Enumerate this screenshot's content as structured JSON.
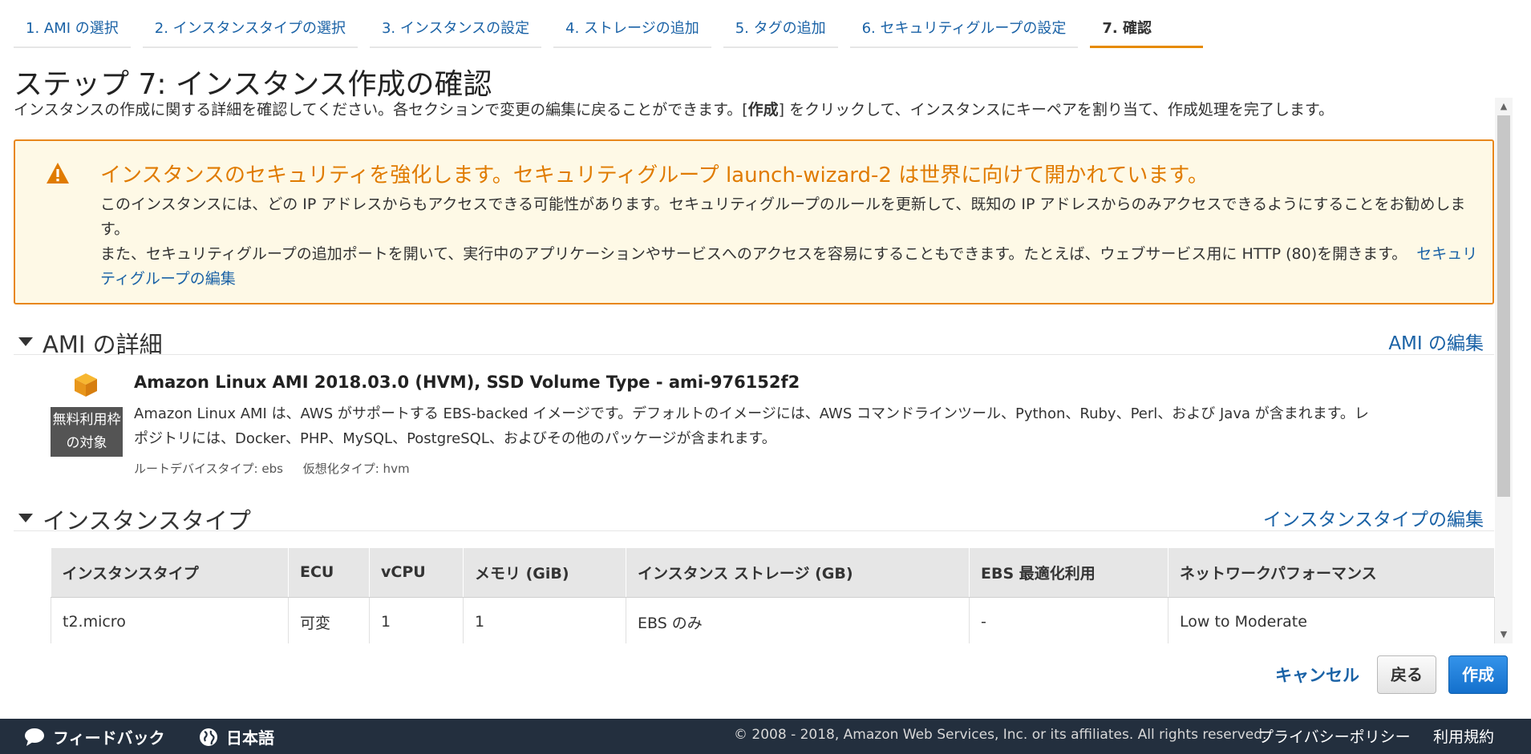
{
  "wizard": {
    "tabs": [
      {
        "label": "1. AMI の選択"
      },
      {
        "label": "2. インスタンスタイプの選択"
      },
      {
        "label": "3. インスタンスの設定"
      },
      {
        "label": "4. ストレージの追加"
      },
      {
        "label": "5. タグの追加"
      },
      {
        "label": "6. セキュリティグループの設定"
      },
      {
        "label": "7. 確認"
      }
    ],
    "active_tab": "7. 確認"
  },
  "page": {
    "title": "ステップ 7: インスタンス作成の確認",
    "desc_before": "インスタンスの作成に関する詳細を確認してください。各セクションで変更の編集に戻ることができます。[",
    "desc_bold": "作成",
    "desc_after": "] をクリックして、インスタンスにキーペアを割り当て、作成処理を完了します。"
  },
  "warning": {
    "icon": "warning-triangle-icon",
    "title": "インスタンスのセキュリティを強化します。セキュリティグループ launch-wizard-2 は世界に向けて開かれています。",
    "line1": "このインスタンスには、どの IP アドレスからもアクセスできる可能性があります。セキュリティグループのルールを更新して、既知の IP アドレスからのみアクセスできるようにすることをお勧めします。",
    "line2": "また、セキュリティグループの追加ポートを開いて、実行中のアプリケーションやサービスへのアクセスを容易にすることもできます。たとえば、ウェブサービス用に HTTP (80)を開きます。",
    "link": "セキュリティグループの編集",
    "color": "#e07b00"
  },
  "ami_section": {
    "title": "AMI の詳細",
    "edit_link": "AMI の編集",
    "badge": "無料利用枠の対象",
    "name": "Amazon Linux AMI 2018.03.0 (HVM), SSD Volume Type - ami-976152f2",
    "description": "Amazon Linux AMI は、AWS がサポートする EBS-backed イメージです。デフォルトのイメージには、AWS コマンドラインツール、Python、Ruby、Perl、および Java が含まれます。レポジトリには、Docker、PHP、MySQL、PostgreSQL、およびその他のパッケージが含まれます。",
    "root_device": "ルートデバイスタイプ: ebs",
    "virtualization": "仮想化タイプ: hvm"
  },
  "instance_section": {
    "title": "インスタンスタイプ",
    "edit_link": "インスタンスタイプの編集",
    "columns": [
      "インスタンスタイプ",
      "ECU",
      "vCPU",
      "メモリ (GiB)",
      "インスタンス ストレージ (GB)",
      "EBS 最適化利用",
      "ネットワークパフォーマンス"
    ],
    "rows": [
      [
        "t2.micro",
        "可変",
        "1",
        "1",
        "EBS のみ",
        "-",
        "Low to Moderate"
      ]
    ]
  },
  "actions": {
    "cancel": "キャンセル",
    "back": "戻る",
    "launch": "作成",
    "launch_color": "#1470cc"
  },
  "footer": {
    "feedback": "フィードバック",
    "language": "日本語",
    "copyright": "© 2008 - 2018, Amazon Web Services, Inc. or its affiliates. All rights reserved.",
    "privacy": "プライバシーポリシー",
    "terms": "利用規約"
  }
}
